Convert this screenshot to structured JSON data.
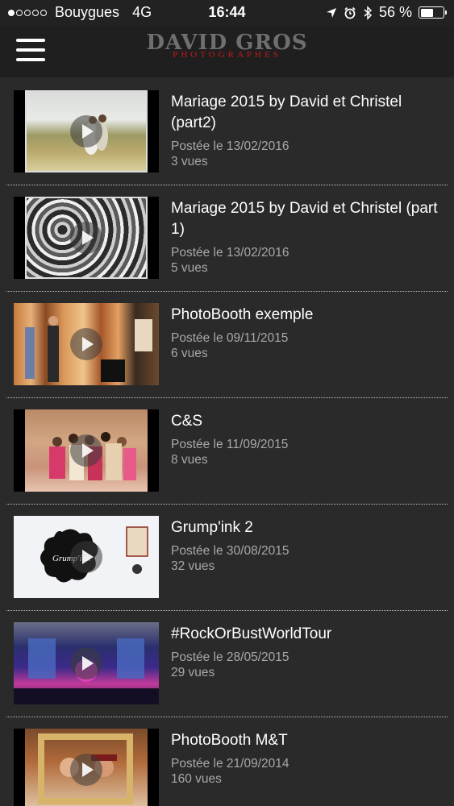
{
  "status_bar": {
    "carrier": "Bouygues",
    "network": "4G",
    "time": "16:44",
    "battery": "56 %",
    "battery_level": 0.56,
    "icons": [
      "location-arrow-icon",
      "alarm-clock-icon",
      "bluetooth-icon",
      "battery-icon"
    ]
  },
  "header": {
    "logo_title": "DAVID GROS",
    "logo_subtitle": "PHOTOGRAPHES",
    "logo_subtitle_color": "#c8161d",
    "menu_icon": "hamburger-menu-icon"
  },
  "videos": [
    {
      "title": "Mariage 2015 by David et Christel (part2)",
      "date": "Postée le 13/02/2016",
      "views": "3 vues"
    },
    {
      "title": "Mariage 2015 by David et Christel (part 1)",
      "date": "Postée le 13/02/2016",
      "views": "5 vues"
    },
    {
      "title": "PhotoBooth exemple",
      "date": "Postée le 09/11/2015",
      "views": "6 vues"
    },
    {
      "title": "C&S",
      "date": "Postée le 11/09/2015",
      "views": "8 vues"
    },
    {
      "title": "Grump'ink 2",
      "date": "Postée le 30/08/2015",
      "views": "32 vues"
    },
    {
      "title": "#RockOrBustWorldTour",
      "date": "Postée le 28/05/2015",
      "views": "29 vues"
    },
    {
      "title": "PhotoBooth M&T",
      "date": "Postée le 21/09/2014",
      "views": "160 vues"
    }
  ]
}
